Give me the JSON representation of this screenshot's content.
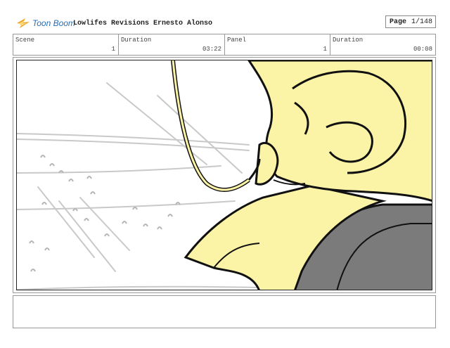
{
  "header": {
    "brand": "Toon Boom",
    "title": "Lowlifes Revisions Ernesto Alonso",
    "page_label": "Page",
    "page_value": "1/148"
  },
  "info": {
    "scene_label": "Scene",
    "scene_value": "1",
    "duration_label": "Duration",
    "scene_duration": "03:22",
    "panel_label": "Panel",
    "panel_value": "1",
    "panel_duration_label": "Duration",
    "panel_duration": "00:08"
  },
  "panel": {
    "drawing": "storyboard-sketch",
    "colors": {
      "skin": "#fbf3a6",
      "seat": "#7b7b7b",
      "ink": "#111111",
      "speed_lines": "#c8c8c8"
    }
  },
  "notes": {
    "text": ""
  }
}
